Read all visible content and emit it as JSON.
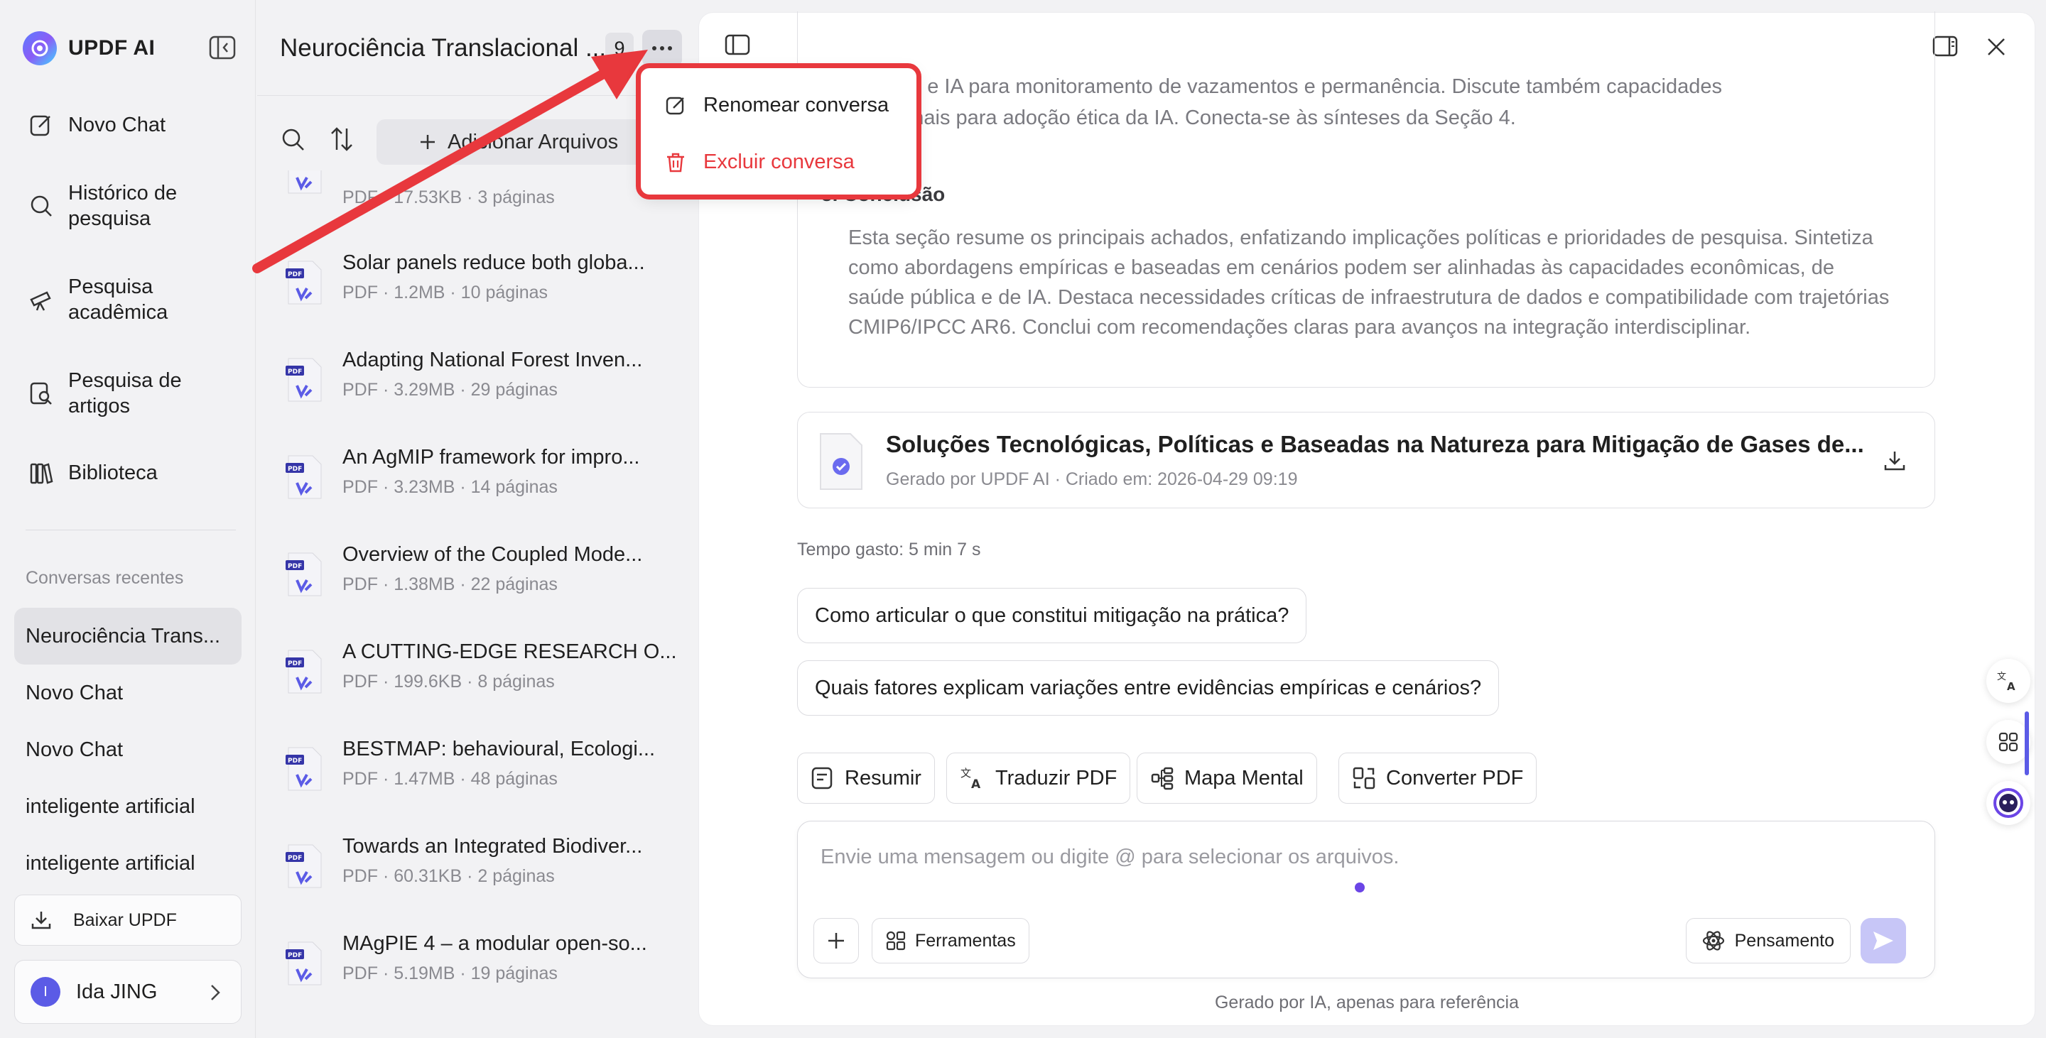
{
  "app": {
    "name": "UPDF AI"
  },
  "nav": {
    "new_chat": "Novo Chat",
    "history": [
      "Histórico de",
      "pesquisa"
    ],
    "academic": [
      "Pesquisa",
      "acadêmica"
    ],
    "articles": [
      "Pesquisa de",
      "artigos"
    ],
    "library": "Biblioteca"
  },
  "recent": {
    "title": "Conversas recentes",
    "items": [
      {
        "label": "Neurociência Trans..."
      },
      {
        "label": "Novo Chat"
      },
      {
        "label": "Novo Chat"
      },
      {
        "label": "inteligente artificial"
      },
      {
        "label": "inteligente artificial"
      }
    ]
  },
  "download_label": "Baixar UPDF",
  "user": {
    "initial": "I",
    "name": "Ida JING"
  },
  "conversation": {
    "title": "Neurociência Translacional ...",
    "file_count": "9"
  },
  "files_toolbar": {
    "add_label": "Adicionar Arquivos"
  },
  "files": [
    {
      "name": "",
      "meta": "PDF · 17.53KB · 3 páginas"
    },
    {
      "name": "Solar panels reduce both globa...",
      "meta": "PDF · 1.2MB · 10 páginas"
    },
    {
      "name": "Adapting National Forest Inven...",
      "meta": "PDF · 3.29MB · 29 páginas"
    },
    {
      "name": "An AgMIP framework for impro...",
      "meta": "PDF · 3.23MB · 14 páginas"
    },
    {
      "name": "Overview of the Coupled Mode...",
      "meta": "PDF · 1.38MB · 22 páginas"
    },
    {
      "name": "A CUTTING-EDGE RESEARCH O...",
      "meta": "PDF · 199.6KB · 8 páginas"
    },
    {
      "name": "BESTMAP: behavioural, Ecologi...",
      "meta": "PDF · 1.47MB · 48 páginas"
    },
    {
      "name": "Towards an Integrated Biodiver...",
      "meta": "PDF · 60.31KB · 2 páginas"
    },
    {
      "name": "MAgPIE 4 – a modular open-so...",
      "meta": "PDF · 5.19MB · 19 páginas"
    }
  ],
  "context_menu": {
    "rename": "Renomear conversa",
    "delete": "Excluir conversa"
  },
  "outline": {
    "line1": "onomia, e IA para monitoramento de vazamentos e permanência. Discute também capacidades",
    "line2": "stitucionais para adoção ética da IA. Conecta-se às sínteses da Seção 4.",
    "section_heading": "5. Conclusão",
    "paragraph": "Esta seção resume os principais achados, enfatizando implicações políticas e prioridades de pesquisa. Sintetiza como abordagens empíricas e baseadas em cenários podem ser alinhadas às capacidades econômicas, de saúde pública e de IA. Destaca necessidades críticas de infraestrutura de dados e compatibilidade com trajetórias CMIP6/IPCC AR6. Conclui com recomendações claras para avanços na integração interdisciplinar."
  },
  "doc_card": {
    "title": "Soluções Tecnológicas, Políticas e Baseadas na Natureza para Mitigação de Gases de...",
    "meta": "Gerado por UPDF AI · Criado em: 2026-04-29 09:19"
  },
  "time_spent": "Tempo gasto: 5 min 7 s",
  "suggestions": [
    "Como articular o que constitui mitigação na prática?",
    "Quais fatores explicam variações entre evidências empíricas e cenários?"
  ],
  "tools": {
    "summarize": "Resumir",
    "translate": "Traduzir PDF",
    "mindmap": "Mapa Mental",
    "convert": "Converter PDF"
  },
  "composer": {
    "placeholder": "Envie uma mensagem ou digite @ para selecionar os arquivos.",
    "tools_label": "Ferramentas",
    "thinking_label": "Pensamento"
  },
  "footnote": "Gerado por IA, apenas para referência",
  "colors": {
    "accent": "#5b5be6",
    "danger": "#e8383d",
    "send_disabled": "#c7c6f7"
  }
}
